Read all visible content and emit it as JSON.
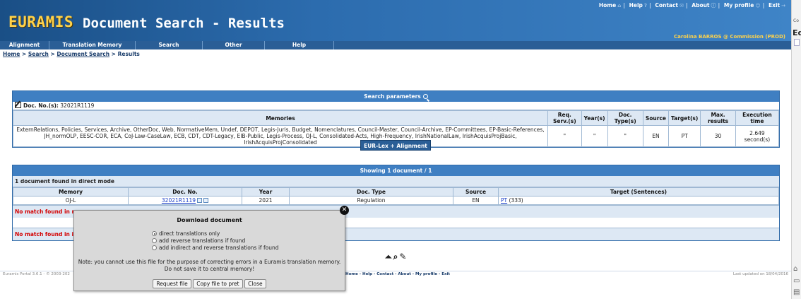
{
  "header": {
    "brand": "EURAMIS",
    "title": "Document Search - Results",
    "top_links": [
      "Home",
      "Help",
      "Contact",
      "About",
      "My profile",
      "Exit"
    ],
    "user": "Carolina BARROS @ Commission (PROD)"
  },
  "nav": [
    "Alignment",
    "Translation Memory",
    "Search",
    "Other",
    "Help"
  ],
  "breadcrumb": [
    "Home",
    "Search",
    "Document Search",
    "Results"
  ],
  "params": {
    "head": "Search parameters",
    "docno_label": "Doc. No.(s):",
    "docno_value": "32021R1119",
    "headers": [
      "Memories",
      "Req. Serv.(s)",
      "Year(s)",
      "Doc. Type(s)",
      "Source",
      "Target(s)",
      "Max. results",
      "Execution time"
    ],
    "memories": "ExternRelations, Policies, Services, Archive, OtherDoc, Web, NormativeMem, Undef, DEPOT, Legis-Juris, Budget, Nomenclatures, Council-Master, Council-Archive, EP-Committees, EP-Basic-References, JH_normOLP, EESC-COR, ECA, CoJ-Law-CaseLaw, ECB, CDT, CDT-Legacy, EIB-Public, Legis-Process, OJ-L, Consolidated-Acts, High-Frequency, IrishNationalLaw, IrishAcquisProjBasic, IrishAcquisProjConsolidated",
    "req_serv": "\"",
    "years": "\"",
    "doc_types": "\"",
    "source": "EN",
    "target": "PT",
    "max_results": "30",
    "exec_time": "2.649 second(s)"
  },
  "eurlex_button": "EUR-Lex + Alignment",
  "results": {
    "head": "Showing 1 document / 1",
    "found": "1 document found in direct mode",
    "headers": [
      "Memory",
      "Doc. No.",
      "Year",
      "Doc. Type",
      "Source",
      "Target (Sentences)"
    ],
    "row": {
      "memory": "OJ-L",
      "docno": "32021R1119",
      "year": "2021",
      "doctype": "Regulation",
      "source": "EN",
      "target_lang": "PT",
      "target_count": "(333)"
    },
    "nomatch1": "No match found in r",
    "nomatch2": "No match found in i"
  },
  "dialog": {
    "title": "Download document",
    "options": [
      {
        "label": "direct translations only",
        "selected": true
      },
      {
        "label": "add reverse translations if found",
        "selected": false
      },
      {
        "label": "add indirect and reverse translations if found",
        "selected": false
      }
    ],
    "note1": "Note: you cannot use this file for the purpose of correcting errors in a Euramis translation memory.",
    "note2": "Do not save it to central memory!",
    "buttons": [
      "Request file",
      "Copy file to pret",
      "Close"
    ]
  },
  "footer": {
    "left": "Euramis Portal 3.6.1 - © 2003-202",
    "links": [
      "Home",
      "Help",
      "Contact",
      "About",
      "My profile",
      "Exit"
    ],
    "right": "Last updated on 18/04/2016"
  },
  "right_strip": {
    "small": "Co",
    "big": "Ed"
  }
}
